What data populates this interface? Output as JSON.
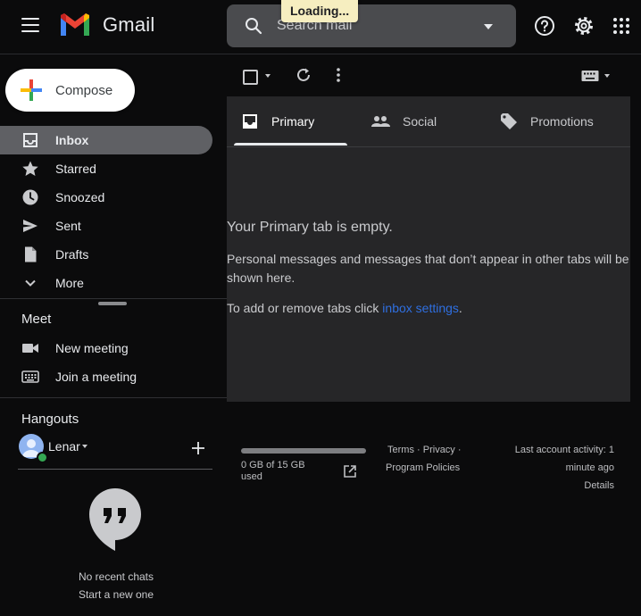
{
  "header": {
    "brand": "Gmail",
    "search_placeholder": "Search mail",
    "loading_banner": "Loading..."
  },
  "compose": {
    "label": "Compose"
  },
  "sidebar": {
    "items": [
      {
        "label": "Inbox",
        "icon": "inbox-icon",
        "active": true
      },
      {
        "label": "Starred",
        "icon": "star-icon"
      },
      {
        "label": "Snoozed",
        "icon": "clock-icon"
      },
      {
        "label": "Sent",
        "icon": "send-icon"
      },
      {
        "label": "Drafts",
        "icon": "draft-icon"
      },
      {
        "label": "More",
        "icon": "chevron-down-icon"
      }
    ],
    "meet": {
      "title": "Meet",
      "items": [
        {
          "label": "New meeting",
          "icon": "video-icon"
        },
        {
          "label": "Join a meeting",
          "icon": "keyboard-icon"
        }
      ]
    },
    "hangouts": {
      "title": "Hangouts",
      "user_name": "Lenar",
      "no_chats": "No recent chats",
      "start_chat": "Start a new one"
    }
  },
  "tabs": [
    {
      "label": "Primary",
      "icon": "inbox-tab-icon",
      "active": true
    },
    {
      "label": "Social",
      "icon": "people-icon"
    },
    {
      "label": "Promotions",
      "icon": "tag-icon"
    }
  ],
  "empty_state": {
    "title": "Your Primary tab is empty.",
    "body": "Personal messages and messages that don’t appear in other tabs will be shown here.",
    "settings_prefix": "To add or remove tabs click ",
    "settings_link": "inbox settings",
    "settings_suffix": "."
  },
  "footer": {
    "storage_used_gb": 0,
    "storage_text": "0 GB of 15 GB used",
    "terms": "Terms",
    "privacy": "Privacy",
    "program_policies": "Program Policies",
    "activity_line1": "Last account activity: 1",
    "activity_line2": "minute ago",
    "details": "Details"
  },
  "colors": {
    "background": "#0b0b0c",
    "panel": "#262628",
    "active_nav": "#5f6064",
    "link": "#2f6fe0",
    "loading_banner": "#f6eec0"
  }
}
